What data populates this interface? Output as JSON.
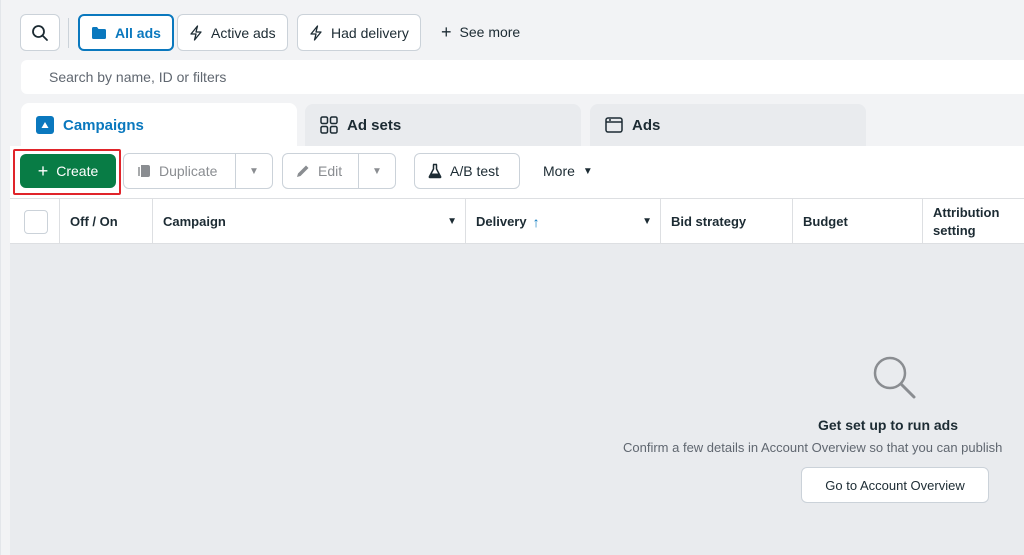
{
  "filters": {
    "all_ads": "All ads",
    "active_ads": "Active ads",
    "had_delivery": "Had delivery",
    "see_more": "See more"
  },
  "search": {
    "placeholder": "Search by name, ID or filters"
  },
  "tabs": [
    {
      "label": "Campaigns",
      "icon": "campaigns-icon",
      "selected": true
    },
    {
      "label": "Ad sets",
      "icon": "adsets-grid-icon"
    },
    {
      "label": "Ads",
      "icon": "ads-window-icon"
    }
  ],
  "toolbar": {
    "create": "Create",
    "duplicate": "Duplicate",
    "edit": "Edit",
    "ab_test": "A/B test",
    "more": "More"
  },
  "columns": {
    "off_on": "Off / On",
    "campaign": "Campaign",
    "delivery": "Delivery",
    "delivery_sort": "↑",
    "bid_strategy": "Bid strategy",
    "budget": "Budget",
    "attribution_line1": "Attribution",
    "attribution_line2": "setting"
  },
  "empty_state": {
    "title": "Get set up to run ads",
    "subtitle": "Confirm a few details in Account Overview so that you can publish",
    "button": "Go to Account Overview"
  },
  "colors": {
    "accent": "#0a78be",
    "create_green": "#087c45",
    "highlight_red": "#e0242a"
  }
}
